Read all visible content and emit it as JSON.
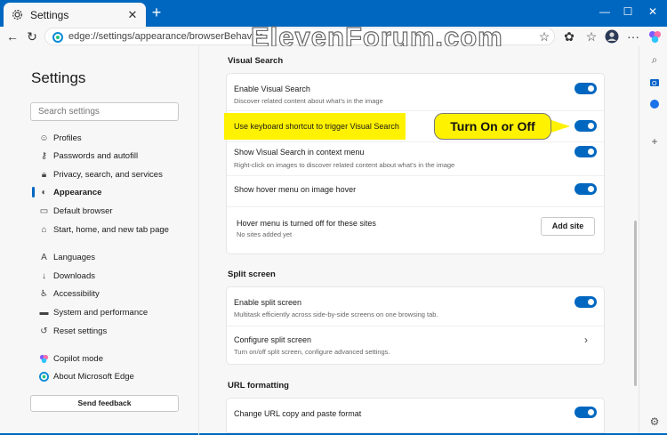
{
  "window": {
    "tab_title": "Settings",
    "tab_icon": "gear-icon",
    "minimize": "—",
    "maximize": "☐",
    "close": "✕"
  },
  "address_bar": {
    "url": "edge://settings/appearance/browserBehavior"
  },
  "watermark": "ElevenForum.com",
  "sidebar": {
    "title": "Settings",
    "search_placeholder": "Search settings",
    "items": [
      {
        "label": "Profiles",
        "icon": "profile-icon"
      },
      {
        "label": "Passwords and autofill",
        "icon": "key-icon"
      },
      {
        "label": "Privacy, search, and services",
        "icon": "lock-icon"
      },
      {
        "label": "Appearance",
        "icon": "appearance-icon",
        "active": true
      },
      {
        "label": "Default browser",
        "icon": "browser-icon"
      },
      {
        "label": "Start, home, and new tab page",
        "icon": "home-icon"
      },
      {
        "label": "Languages",
        "icon": "languages-icon"
      },
      {
        "label": "Downloads",
        "icon": "download-icon"
      },
      {
        "label": "Accessibility",
        "icon": "accessibility-icon"
      },
      {
        "label": "System and performance",
        "icon": "system-icon"
      },
      {
        "label": "Reset settings",
        "icon": "reset-icon"
      },
      {
        "label": "Copilot mode",
        "icon": "copilot-icon"
      },
      {
        "label": "About Microsoft Edge",
        "icon": "edge-icon"
      }
    ],
    "feedback_label": "Send feedback"
  },
  "visual_search": {
    "heading": "Visual Search",
    "enable_title": "Enable Visual Search",
    "enable_desc": "Discover related content about what's in the image",
    "shortcut_title": "Use keyboard shortcut to trigger Visual Search",
    "context_title": "Show Visual Search in context menu",
    "context_desc": "Right-click on images to discover related content about what's in the image",
    "hover_title": "Show hover menu on image hover",
    "hover_off_title": "Hover menu is turned off for these sites",
    "hover_off_desc": "No sites added yet",
    "add_site_label": "Add site"
  },
  "split_screen": {
    "heading": "Split screen",
    "enable_title": "Enable split screen",
    "enable_desc": "Multitask efficiently across side-by-side screens on one browsing tab.",
    "configure_title": "Configure split screen",
    "configure_desc": "Turn on/off split screen, configure advanced settings."
  },
  "url_formatting": {
    "heading": "URL formatting",
    "change_title": "Change URL copy and paste format"
  },
  "callout": {
    "text": "Turn On or Off"
  },
  "toggles": {
    "enable_visual_search": true,
    "keyboard_shortcut": true,
    "context_menu": true,
    "hover_menu": true,
    "split_screen": true,
    "url_format": true
  },
  "colors": {
    "accent": "#0067c0",
    "highlight": "#fff200"
  }
}
